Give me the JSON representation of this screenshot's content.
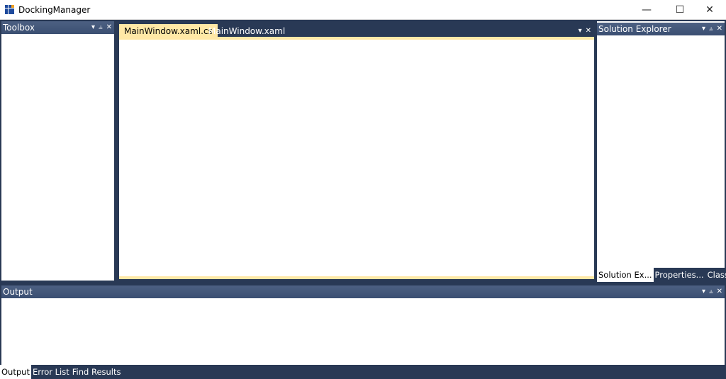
{
  "window": {
    "title": "DockingManager",
    "minimize_glyph": "—",
    "maximize_glyph": "☐",
    "close_glyph": "✕",
    "icon_colors": [
      "#1e4a9c",
      "#1e4a9c",
      "#f0a020",
      "#1e4a9c",
      "#1e4a9c",
      "#1e4a9c",
      "#1e4a9c",
      "#1e4a9c",
      "#1e4a9c"
    ]
  },
  "panel_buttons": {
    "menu": "▾",
    "pin": "⫨",
    "close": "✕"
  },
  "toolbox": {
    "title": "Toolbox"
  },
  "documents": {
    "tabs": [
      {
        "label": "MainWindow.xaml.cs",
        "active": true
      },
      {
        "label": "MainWindow.xaml",
        "active": false
      }
    ]
  },
  "solution_explorer": {
    "title": "Solution Explorer",
    "tabs": [
      {
        "label": "Solution Ex...",
        "selected": true
      },
      {
        "label": "Properties...",
        "selected": false
      },
      {
        "label": "Class View",
        "selected": false
      }
    ]
  },
  "output": {
    "title": "Output",
    "tabs": [
      {
        "label": "Output",
        "selected": true
      },
      {
        "label": "Error List",
        "selected": false
      },
      {
        "label": "Find Results",
        "selected": false
      }
    ]
  },
  "colors": {
    "frame": "#293955",
    "header": "#3b4f72",
    "active_tab": "#ffe8a6"
  }
}
